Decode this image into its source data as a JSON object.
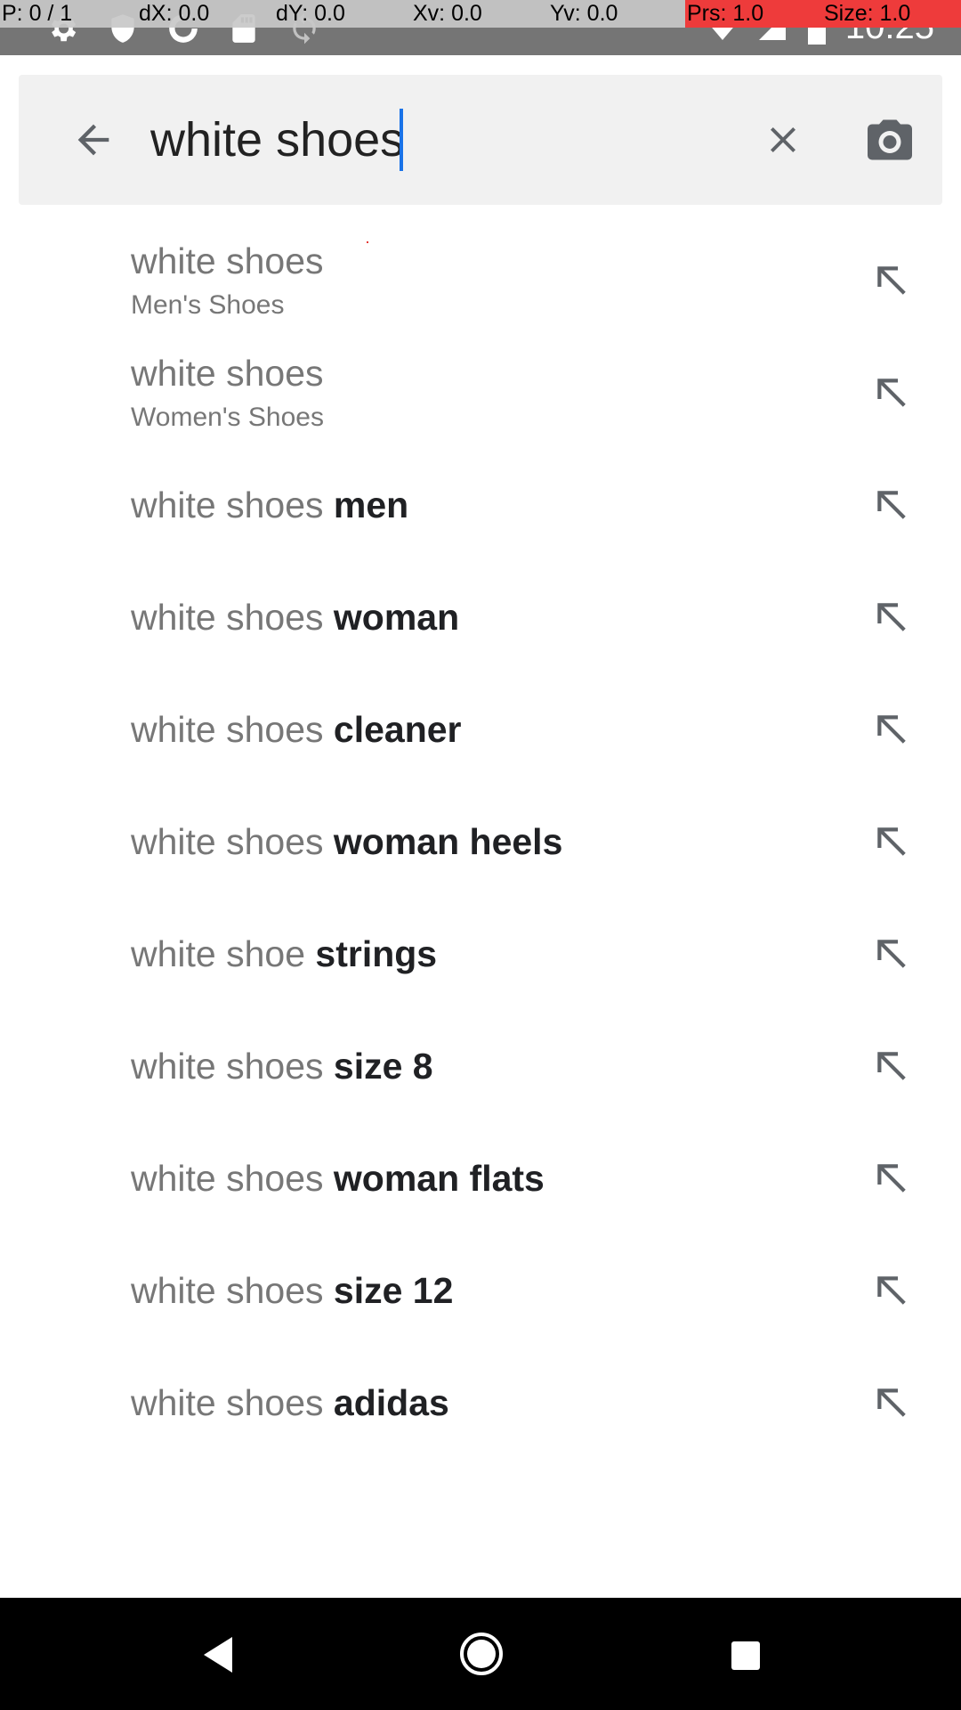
{
  "status_bar": {
    "time": "10:25",
    "left_icons": [
      "settings-icon",
      "shield-icon",
      "data-saver-icon",
      "sd-card-icon",
      "sync-icon"
    ],
    "right_icons": [
      "wifi-icon",
      "signal-icon",
      "battery-icon"
    ]
  },
  "pointer_overlay": {
    "p": "P: 0 / 1",
    "dx": "dX: 0.0",
    "dy": "dY: 0.0",
    "xv": "Xv: 0.0",
    "yv": "Yv: 0.0",
    "prs": "Prs: 1.0",
    "size": "Size: 1.0"
  },
  "search": {
    "query": "white shoes",
    "back_icon": "arrow-back-icon",
    "clear_icon": "close-icon",
    "camera_icon": "camera-icon"
  },
  "suggestions": [
    {
      "type": "two-line",
      "primary": "white shoes",
      "secondary": "Men's Shoes"
    },
    {
      "type": "two-line",
      "primary": "white shoes",
      "secondary": "Women's Shoes"
    },
    {
      "type": "one-line",
      "query": "white shoes ",
      "completion": "men"
    },
    {
      "type": "one-line",
      "query": "white shoes ",
      "completion": "woman"
    },
    {
      "type": "one-line",
      "query": "white shoes ",
      "completion": "cleaner"
    },
    {
      "type": "one-line",
      "query": "white shoes ",
      "completion": "woman heels"
    },
    {
      "type": "one-line",
      "query": "white shoe ",
      "completion": "strings"
    },
    {
      "type": "one-line",
      "query": "white shoes ",
      "completion": "size 8"
    },
    {
      "type": "one-line",
      "query": "white shoes ",
      "completion": "woman flats"
    },
    {
      "type": "one-line",
      "query": "white shoes ",
      "completion": "size 12"
    },
    {
      "type": "one-line",
      "query": "white shoes ",
      "completion": "adidas"
    }
  ],
  "suggestion_action_icon": "arrow-up-left-icon",
  "nav_bar": {
    "icons": [
      "nav-back-icon",
      "nav-home-icon",
      "nav-recents-icon"
    ]
  },
  "colors": {
    "status_bar": "#757575",
    "search_bar": "#f1f1f1",
    "caret": "#1a73e8",
    "suggestion_query": "#777777",
    "suggestion_completion": "#202124",
    "nav_bar": "#000000",
    "overlay_alert": "#ee3b3b"
  }
}
